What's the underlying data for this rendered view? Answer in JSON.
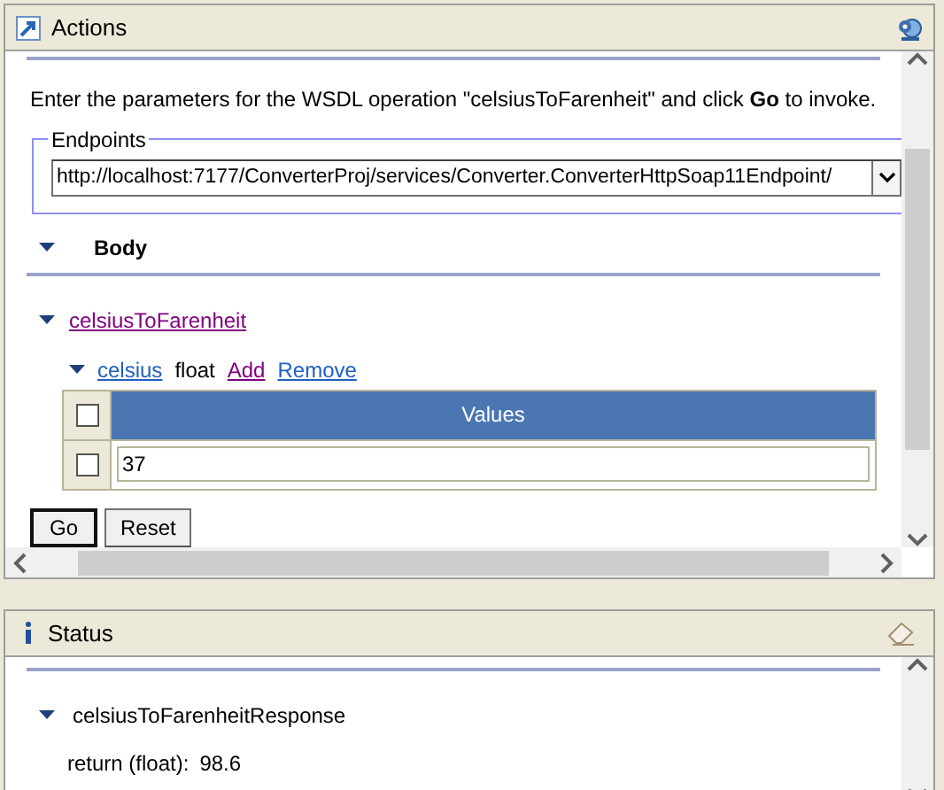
{
  "actions_panel": {
    "title": "Actions",
    "intro": "Enter the parameters for the WSDL operation \"celsiusToFarenheit\" and click **Go** to invoke.",
    "endpoints": {
      "legend": "Endpoints",
      "value": "http://localhost:7177/ConverterProj/services/Converter.ConverterHttpSoap11Endpoint/"
    },
    "body": {
      "label": "Body",
      "expanded": true
    },
    "operation": {
      "label": "celsiusToFarenheit",
      "expanded": true
    },
    "parameter": {
      "name": "celsius",
      "type": "float",
      "add": "Add",
      "remove": "Remove",
      "expanded": true
    },
    "table": {
      "header": {
        "label": "Values",
        "checked": false
      },
      "rows": [
        {
          "value": "37",
          "checked": false
        }
      ]
    },
    "buttons": [
      {
        "label": "Go",
        "default": true
      },
      {
        "label": "Reset",
        "default": false
      }
    ]
  },
  "status_panel": {
    "title": "Status",
    "response": {
      "label": "celsiusToFarenheitResponse",
      "expanded": true
    },
    "result": {
      "label": "return (float):",
      "value": "98.6"
    }
  }
}
